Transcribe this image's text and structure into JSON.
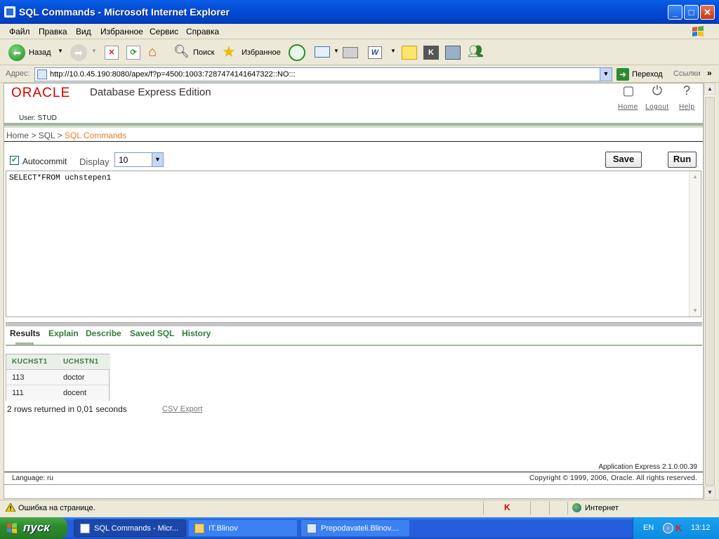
{
  "window": {
    "title": "SQL Commands - Microsoft Internet Explorer"
  },
  "menu": [
    "Файл",
    "Правка",
    "Вид",
    "Избранное",
    "Сервис",
    "Справка"
  ],
  "toolbar": {
    "back_label": "Назад",
    "search_label": "Поиск",
    "favorites_label": "Избранное"
  },
  "address": {
    "label": "Адрес:",
    "url": "http://10.0.45.190:8080/apex/f?p=4500:1003:7287474141647322::NO:::",
    "go_label": "Переход",
    "links_label": "Ссылки"
  },
  "app": {
    "logo": "ORACLE",
    "product": "Database Express Edition",
    "nav_home": "Home",
    "nav_logout": "Logout",
    "nav_help": "Help",
    "user_line": "User: STUD",
    "breadcrumb": {
      "home": "Home",
      "sep1": " > ",
      "sql": "SQL",
      "sep2": " > ",
      "current": "SQL Commands"
    },
    "autocommit_label": "Autocommit",
    "autocommit_checked": true,
    "display_label": "Display",
    "display_value": "10",
    "save_label": "Save",
    "run_label": "Run",
    "sql_text": "SELECT*FROM uchstepen1",
    "tabs": [
      "Results",
      "Explain",
      "Describe",
      "Saved SQL",
      "History"
    ],
    "active_tab": "Results",
    "results": {
      "columns": [
        "KUCHST1",
        "UCHSTN1"
      ],
      "rows": [
        [
          "113",
          "doctor"
        ],
        [
          "111",
          "docent"
        ]
      ]
    },
    "rows_message": "2 rows returned in 0,01 seconds",
    "csv_export": "CSV Export",
    "version": "Application Express 2.1.0.00.39",
    "language": "Language: ru",
    "copyright": "Copyright © 1999, 2006, Oracle. All rights reserved."
  },
  "status": {
    "message": "Ошибка на странице.",
    "zone": "Интернет"
  },
  "taskbar": {
    "start_label": "пуск",
    "tasks": [
      "SQL Commands - Micr...",
      "IT.Blinov",
      "Prepodavateli.Blinov...."
    ],
    "lang": "EN",
    "clock": "13:12"
  },
  "colors": {
    "oracle_red": "#D80000",
    "breadcrumb_current": "#E67E22",
    "tab_green": "#2F7E37"
  }
}
